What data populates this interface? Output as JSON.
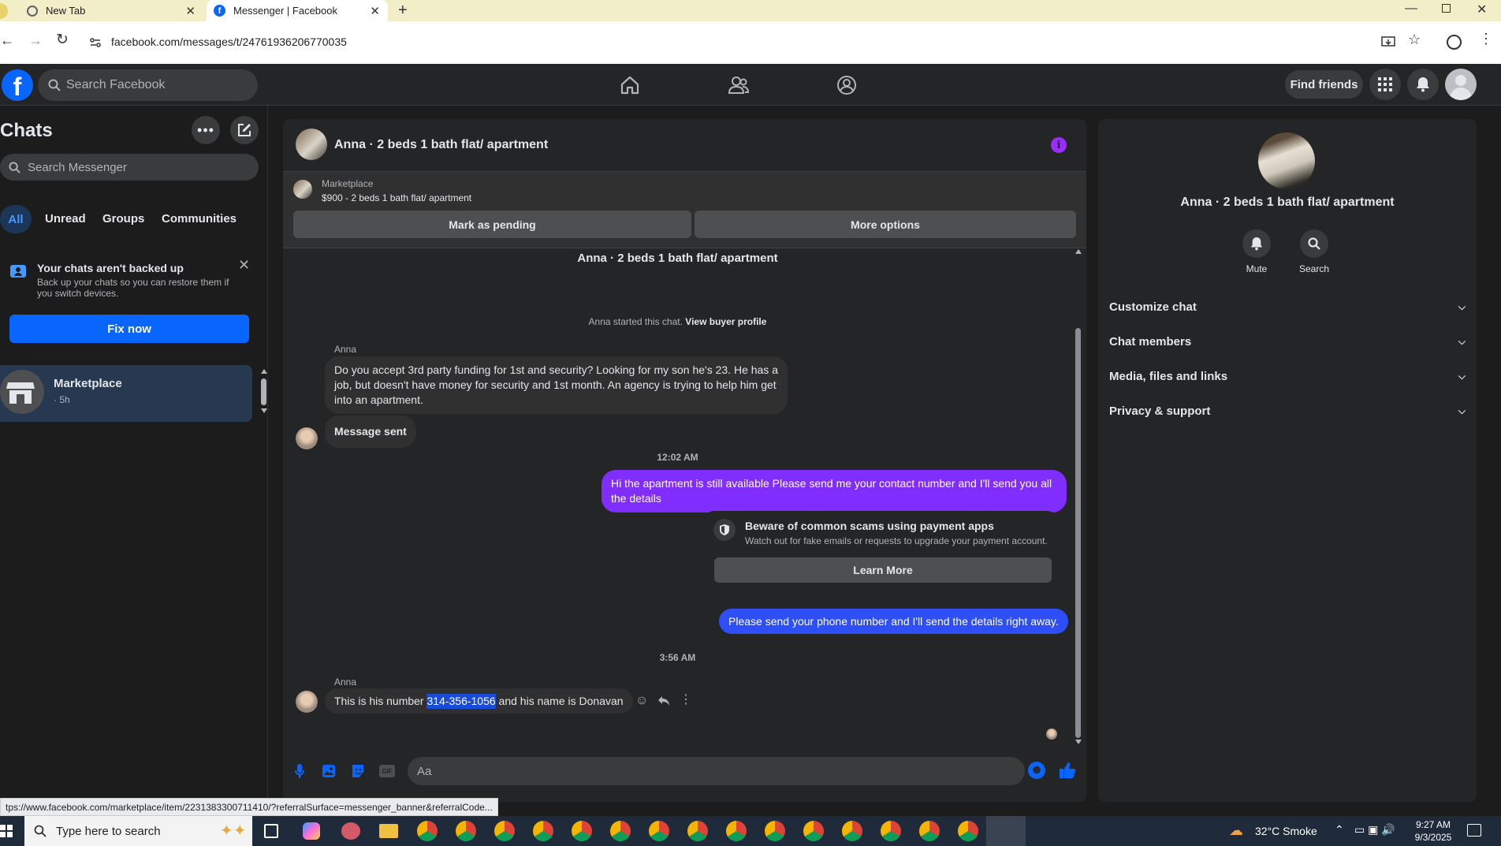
{
  "browser": {
    "tabs": [
      {
        "title": "New Tab"
      },
      {
        "title": "Messenger | Facebook"
      }
    ],
    "url": "facebook.com/messages/t/24761936206770035"
  },
  "fb_nav": {
    "search_placeholder": "Search Facebook",
    "find_friends": "Find friends"
  },
  "sidebar": {
    "title": "Chats",
    "search_placeholder": "Search Messenger",
    "filters": [
      "All",
      "Unread",
      "Groups",
      "Communities"
    ],
    "backup": {
      "title": "Your chats aren't backed up",
      "body": "Back up your chats so you can restore them if you switch devices.",
      "button": "Fix now"
    },
    "conversations": [
      {
        "name": "Marketplace",
        "meta": "· 5h"
      }
    ]
  },
  "chat": {
    "header_title": "Anna · 2 beds 1 bath flat/ apartment",
    "listing": {
      "source": "Marketplace",
      "summary": "$900 - 2 beds 1 bath flat/ apartment",
      "pending_button": "Mark as pending",
      "more_button": "More options"
    },
    "thread_title": "Anna · 2 beds 1 bath flat/ apartment",
    "started_text": "Anna started this chat.",
    "buyer_profile_link": "View buyer profile",
    "sender_name_1": "Anna",
    "msg_1": "Do you accept 3rd party funding for 1st and security? Looking for my son he's 23. He has a job, but doesn't have money for security and 1st month. An agency is trying to help him get into an apartment.",
    "msg_2": "Message sent",
    "time_1": "12:02 AM",
    "msg_3": "Hi the apartment is still available Please send me your contact number and I'll send you all the details",
    "scam_title": "Beware of common scams using payment apps",
    "scam_body": "Watch out for fake emails or requests to upgrade your payment account.",
    "scam_button": "Learn More",
    "msg_4": "Please send your phone number and I'll send the details right away.",
    "time_2": "3:56 AM",
    "sender_name_2": "Anna",
    "msg_5_pre": "This is his number ",
    "msg_5_num": "314-356-1056",
    "msg_5_post": " and his name is Donavan",
    "composer_placeholder": "Aa"
  },
  "info": {
    "name": "Anna · 2 beds 1 bath flat/ apartment",
    "mute": "Mute",
    "search": "Search",
    "sections": [
      "Customize chat",
      "Chat members",
      "Media, files and links",
      "Privacy & support"
    ]
  },
  "status_url": "tps://www.facebook.com/marketplace/item/2231383300711410/?referralSurface=messenger_banner&referralCode...",
  "taskbar": {
    "search_placeholder": "Type here to search",
    "weather": "32°C  Smoke",
    "time": "9:27 AM",
    "date": "9/3/2025"
  },
  "colors": {
    "fb_blue": "#0866ff",
    "accent_purple": "#7f2eff",
    "outgoing_blue": "#2e4ff5"
  }
}
